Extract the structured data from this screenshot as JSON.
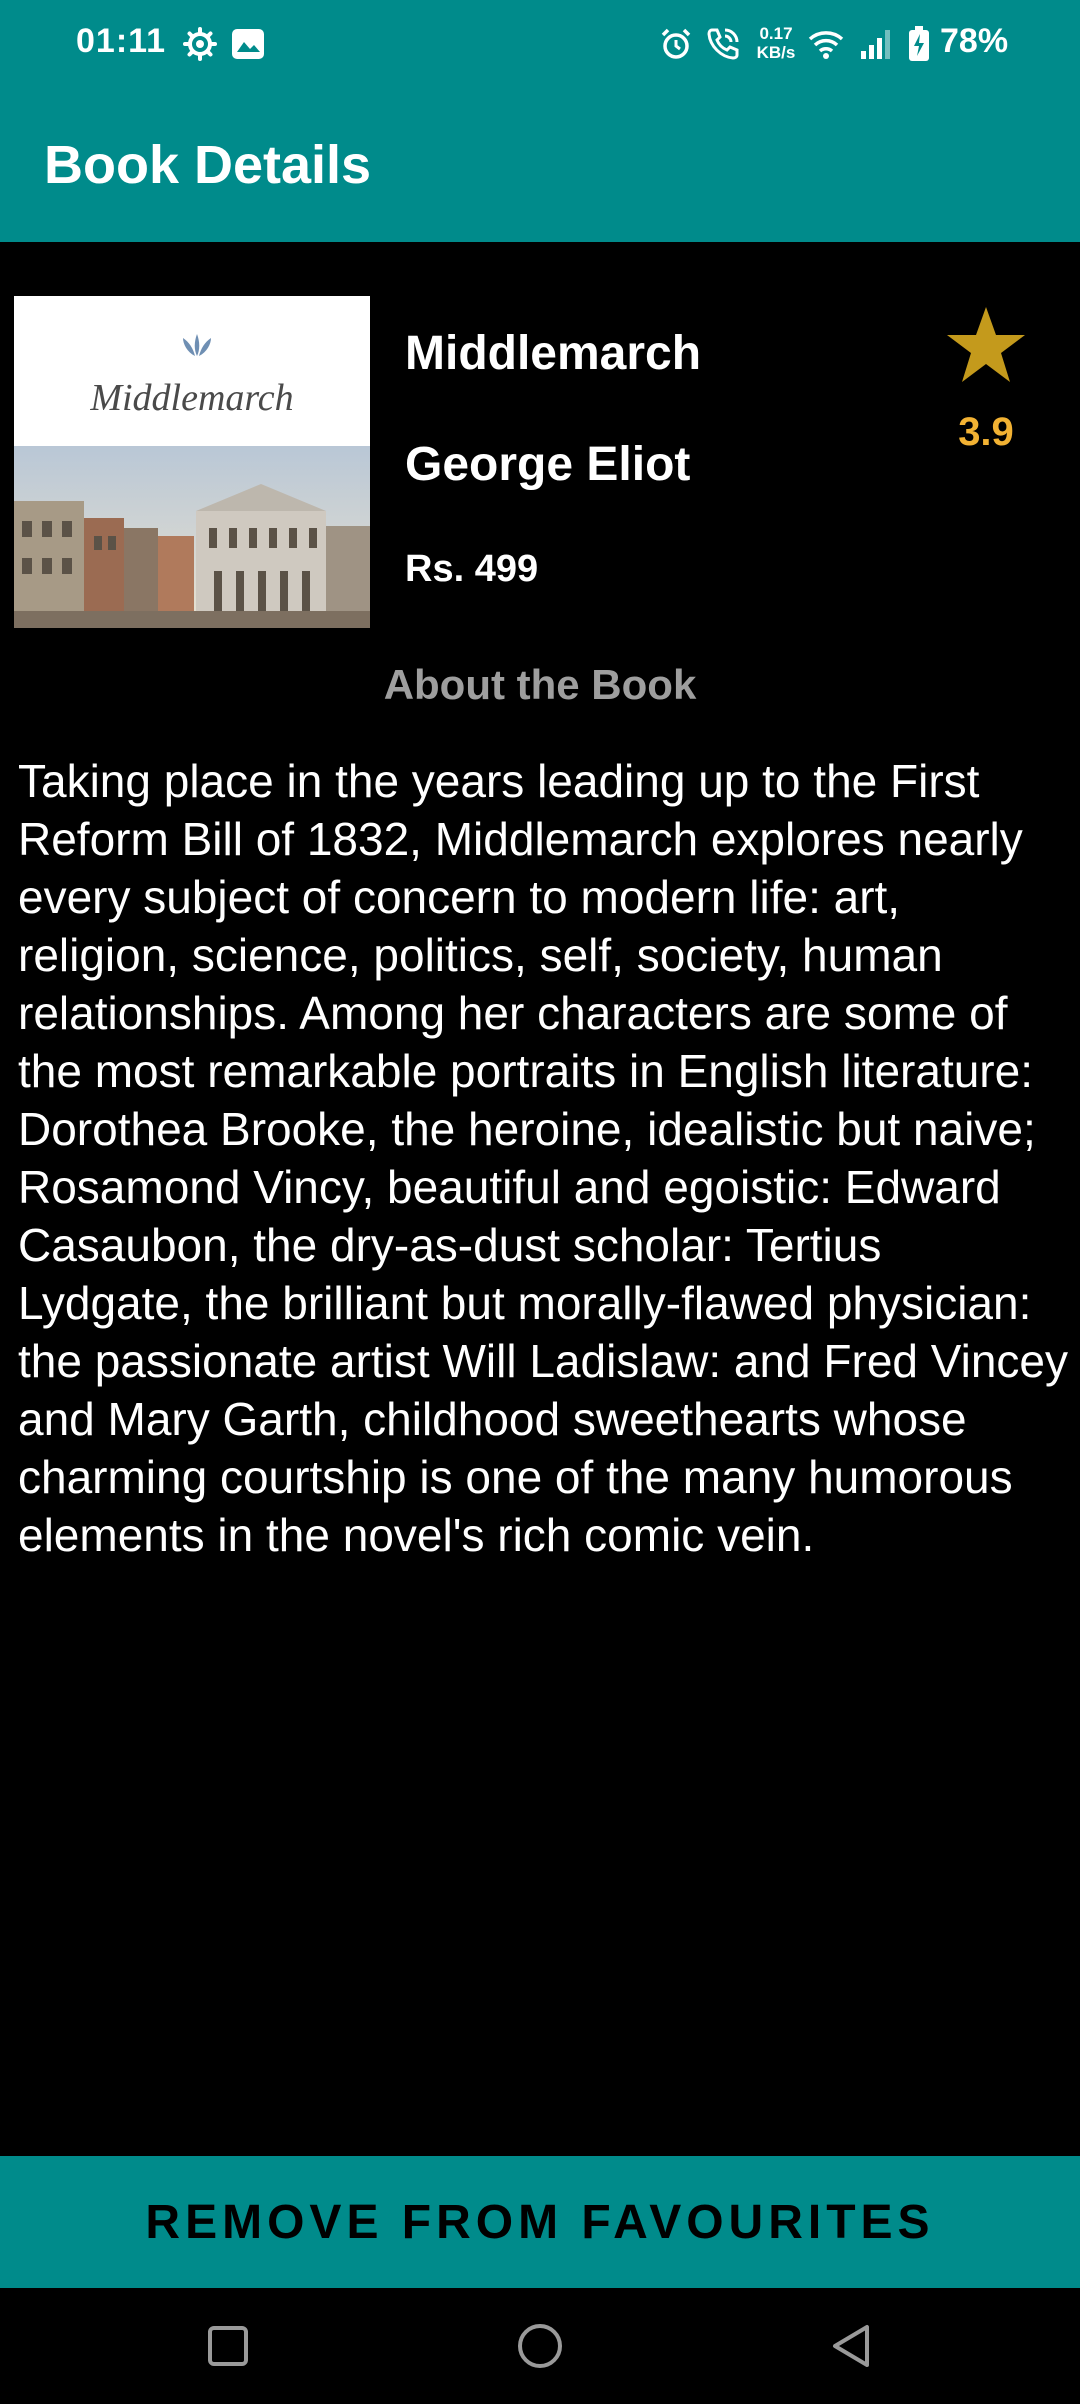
{
  "status_bar": {
    "time": "01:11",
    "network_speed_value": "0.17",
    "network_speed_unit": "KB/s",
    "battery_percent": "78%",
    "icons": [
      "settings-icon",
      "gallery-icon",
      "alarm-icon",
      "wifi-call-icon",
      "wifi-icon",
      "signal-icon",
      "battery-charging-icon"
    ]
  },
  "app_bar": {
    "title": "Book Details"
  },
  "book": {
    "title": "Middlemarch",
    "author": "George Eliot",
    "price": "Rs. 499",
    "rating": "3.9",
    "rating_icon": "star-icon",
    "cover_title": "Middlemarch"
  },
  "about": {
    "heading": "About the Book",
    "description": "Taking place in the years leading up to the First Reform Bill of 1832, Middlemarch explores nearly every subject of concern to modern life: art, religion, science, politics, self, society, human relationships. Among her characters are some of the most remarkable portraits in English literature: Dorothea Brooke, the heroine, idealistic but naive; Rosamond Vincy, beautiful and egoistic: Edward Casaubon, the dry-as-dust scholar: Tertius Lydgate, the brilliant but morally-flawed physician: the passionate artist Will Ladislaw: and Fred Vincey and Mary Garth, childhood sweethearts whose charming courtship is one of the many humorous elements in the novel's rich comic vein."
  },
  "actions": {
    "remove_label": "REMOVE FROM FAVOURITES"
  },
  "nav_bar": {
    "buttons": [
      "recents-icon",
      "home-icon",
      "back-icon"
    ]
  },
  "colors": {
    "primary": "#008B8B",
    "background": "#000000",
    "rating": "#F2B233",
    "star": "#C49A1C",
    "heading_gray": "#9E9E9E"
  }
}
